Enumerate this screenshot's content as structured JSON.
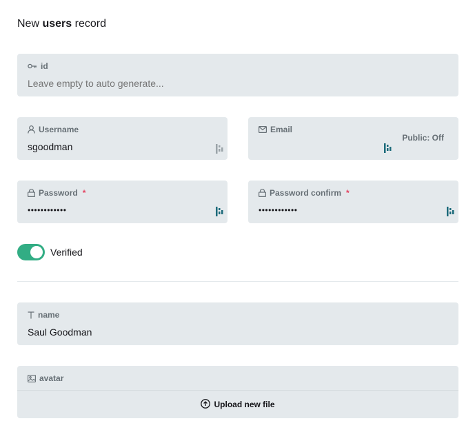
{
  "title": {
    "prefix": "New",
    "collection": "users",
    "suffix": "record"
  },
  "fields": {
    "id": {
      "label": "id",
      "placeholder": "Leave empty to auto generate..."
    },
    "username": {
      "label": "Username",
      "value": "sgoodman"
    },
    "email": {
      "label": "Email",
      "value": "",
      "public_label": "Public: Off"
    },
    "password": {
      "label": "Password",
      "required": "*",
      "value": "••••••••••••"
    },
    "password_confirm": {
      "label": "Password confirm",
      "required": "*",
      "value": "••••••••••••"
    },
    "verified": {
      "label": "Verified",
      "on": true
    },
    "name": {
      "label": "name",
      "value": "Saul Goodman"
    },
    "avatar": {
      "label": "avatar",
      "upload_label": "Upload new file"
    }
  },
  "colors": {
    "field_bg": "#e4e9ec",
    "toggle_on": "#32ad84",
    "required": "#e34562",
    "pm_icon_active": "#1c6a7a",
    "pm_icon_inactive": "#9aa3a8"
  },
  "icons": {
    "id": "key-icon",
    "username": "user-icon",
    "email": "mail-icon",
    "password": "lock-icon",
    "name": "text-icon",
    "avatar": "image-icon",
    "upload": "upload-cloud-icon"
  }
}
